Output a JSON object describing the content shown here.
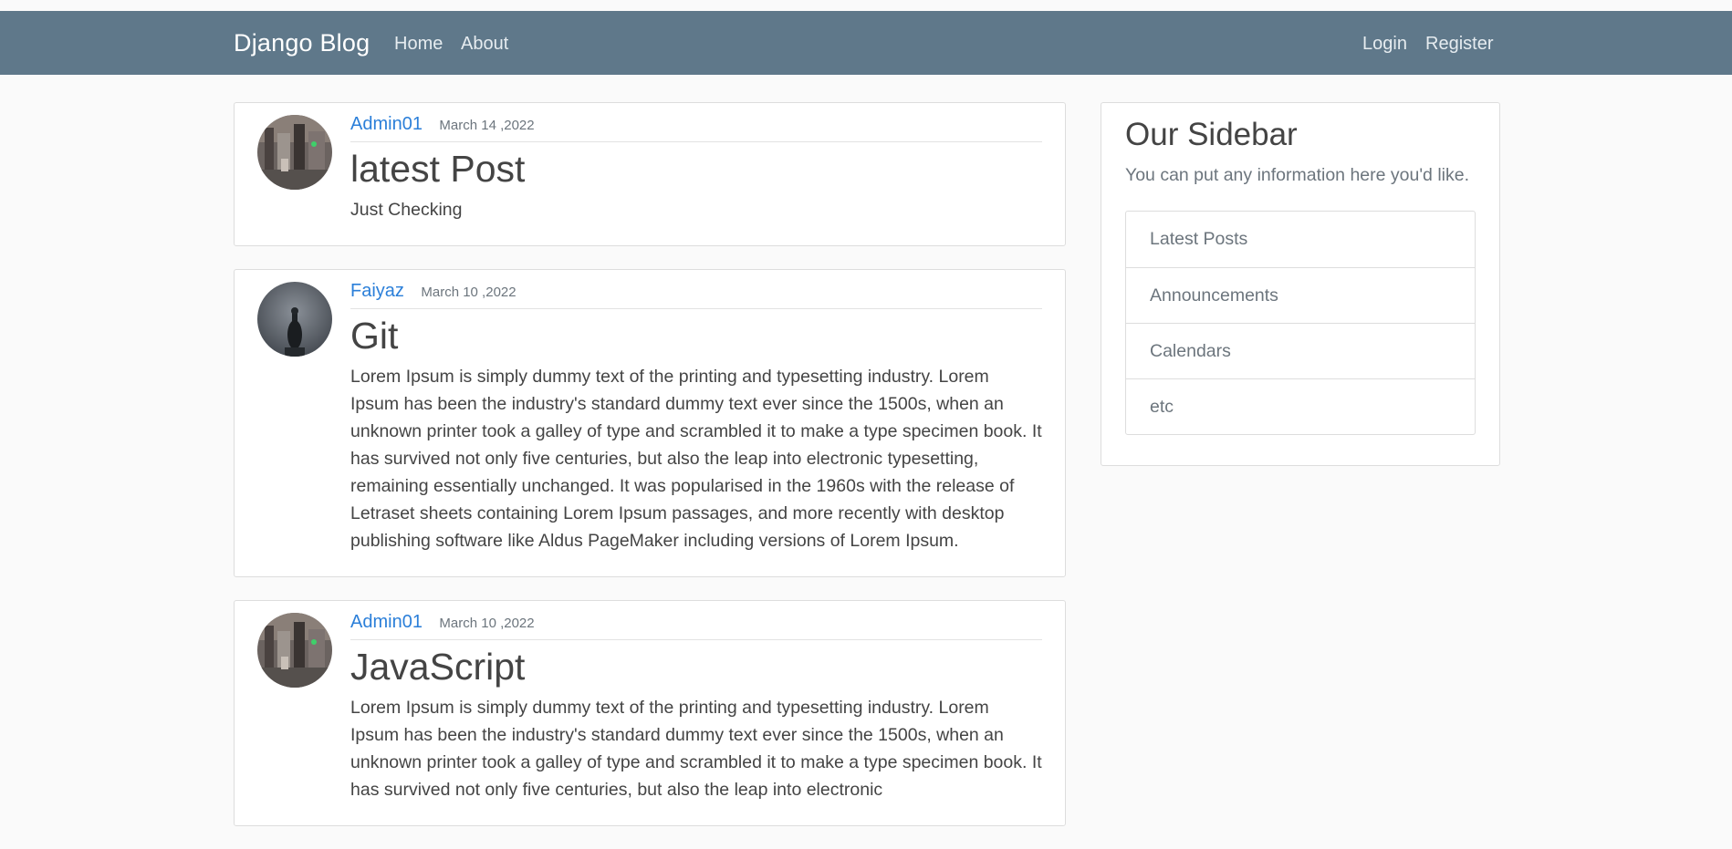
{
  "navbar": {
    "brand": "Django Blog",
    "links_left": [
      "Home",
      "About"
    ],
    "links_right": [
      "Login",
      "Register"
    ],
    "background": "#5f788a"
  },
  "posts": [
    {
      "author": "Admin01",
      "date": "March 14 ,2022",
      "title": "latest Post",
      "content": "Just Checking",
      "avatar": "street-photo-avatar"
    },
    {
      "author": "Faiyaz",
      "date": "March 10 ,2022",
      "title": "Git",
      "content": "Lorem Ipsum is simply dummy text of the printing and typesetting industry. Lorem Ipsum has been the industry's standard dummy text ever since the 1500s, when an unknown printer took a galley of type and scrambled it to make a type specimen book. It has survived not only five centuries, but also the leap into electronic typesetting, remaining essentially unchanged. It was popularised in the 1960s with the release of Letraset sheets containing Lorem Ipsum passages, and more recently with desktop publishing software like Aldus PageMaker including versions of Lorem Ipsum.",
      "avatar": "statue-photo-avatar"
    },
    {
      "author": "Admin01",
      "date": "March 10 ,2022",
      "title": "JavaScript",
      "content": "Lorem Ipsum is simply dummy text of the printing and typesetting industry. Lorem Ipsum has been the industry's standard dummy text ever since the 1500s, when an unknown printer took a galley of type and scrambled it to make a type specimen book. It has survived not only five centuries, but also the leap into electronic",
      "avatar": "street-photo-avatar"
    }
  ],
  "sidebar": {
    "title": "Our Sidebar",
    "description": "You can put any information here you'd like.",
    "items": [
      "Latest Posts",
      "Announcements",
      "Calendars",
      "etc"
    ]
  },
  "colors": {
    "author_link": "#2b7fd9",
    "page_background": "#fafafa"
  }
}
